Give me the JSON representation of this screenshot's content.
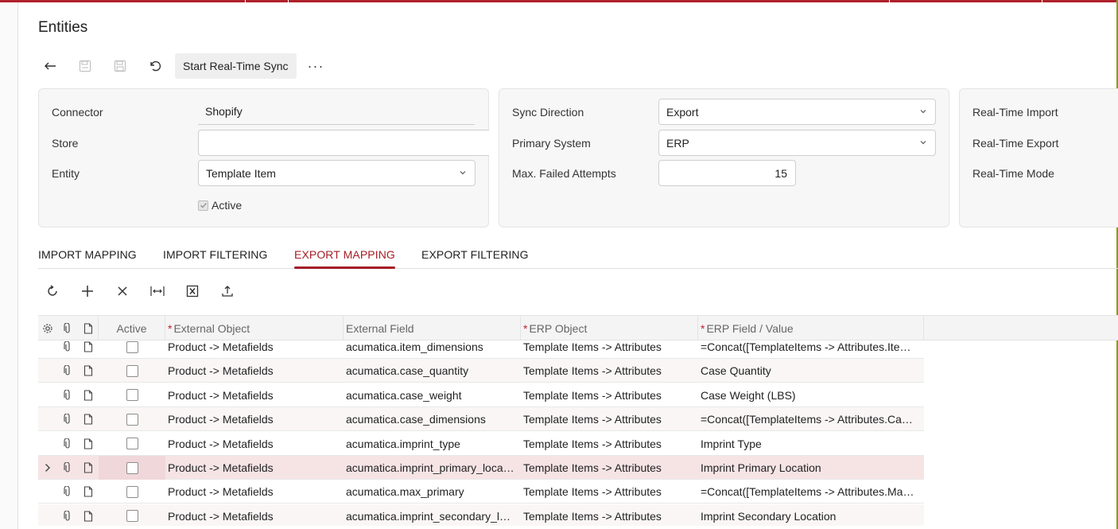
{
  "page": {
    "title": "Entities"
  },
  "toolbar": {
    "back_icon": "back-arrow-icon",
    "save_close_icon": "save-close-icon",
    "save_icon": "save-icon",
    "undo_icon": "undo-icon",
    "start_sync_label": "Start Real-Time Sync",
    "more_label": "···"
  },
  "summary": {
    "connector_label": "Connector",
    "connector_value": "Shopify",
    "store_label": "Store",
    "store_value": "",
    "entity_label": "Entity",
    "entity_value": "Template Item",
    "active_label": "Active",
    "active_checked": true,
    "sync_direction_label": "Sync Direction",
    "sync_direction_value": "Export",
    "primary_system_label": "Primary System",
    "primary_system_value": "ERP",
    "max_failed_label": "Max. Failed Attempts",
    "max_failed_value": "15",
    "rt_import_label": "Real-Time Import",
    "rt_export_label": "Real-Time Export",
    "rt_mode_label": "Real-Time Mode"
  },
  "tabs": [
    {
      "label": "IMPORT MAPPING",
      "active": false
    },
    {
      "label": "IMPORT FILTERING",
      "active": false
    },
    {
      "label": "EXPORT MAPPING",
      "active": true
    },
    {
      "label": "EXPORT FILTERING",
      "active": false
    }
  ],
  "grid_toolbar": [
    "refresh-icon",
    "add-row-icon",
    "delete-row-icon",
    "fit-columns-icon",
    "export-excel-icon",
    "upload-icon"
  ],
  "grid": {
    "headers": {
      "active": "Active",
      "external_object": "External Object",
      "external_field": "External Field",
      "erp_object": "ERP Object",
      "erp_field": "ERP Field / Value"
    },
    "rows": [
      {
        "active": false,
        "external_object": "Product -> Metafields",
        "external_field": "acumatica.item_dimensions",
        "erp_object": "Template Items -> Attributes",
        "erp_field": "=Concat([TemplateItems -> Attributes.Ite…",
        "selected": false
      },
      {
        "active": false,
        "external_object": "Product -> Metafields",
        "external_field": "acumatica.case_quantity",
        "erp_object": "Template Items -> Attributes",
        "erp_field": "Case Quantity",
        "selected": false
      },
      {
        "active": false,
        "external_object": "Product -> Metafields",
        "external_field": "acumatica.case_weight",
        "erp_object": "Template Items -> Attributes",
        "erp_field": "Case Weight (LBS)",
        "selected": false
      },
      {
        "active": false,
        "external_object": "Product -> Metafields",
        "external_field": "acumatica.case_dimensions",
        "erp_object": "Template Items -> Attributes",
        "erp_field": "=Concat([TemplateItems -> Attributes.Ca…",
        "selected": false
      },
      {
        "active": false,
        "external_object": "Product -> Metafields",
        "external_field": "acumatica.imprint_type",
        "erp_object": "Template Items -> Attributes",
        "erp_field": "Imprint Type",
        "selected": false
      },
      {
        "active": false,
        "external_object": "Product -> Metafields",
        "external_field": "acumatica.imprint_primary_loca…",
        "erp_object": "Template Items -> Attributes",
        "erp_field": "Imprint Primary Location",
        "selected": true
      },
      {
        "active": false,
        "external_object": "Product -> Metafields",
        "external_field": "acumatica.max_primary",
        "erp_object": "Template Items -> Attributes",
        "erp_field": "=Concat([TemplateItems -> Attributes.Ma…",
        "selected": false
      },
      {
        "active": false,
        "external_object": "Product -> Metafields",
        "external_field": "acumatica.imprint_secondary_l…",
        "erp_object": "Template Items -> Attributes",
        "erp_field": "Imprint Secondary Location",
        "selected": false
      }
    ]
  },
  "colors": {
    "accent": "#a51d27",
    "selected_row": "#f6e4e5",
    "panel_bg": "#f7f7f7"
  }
}
